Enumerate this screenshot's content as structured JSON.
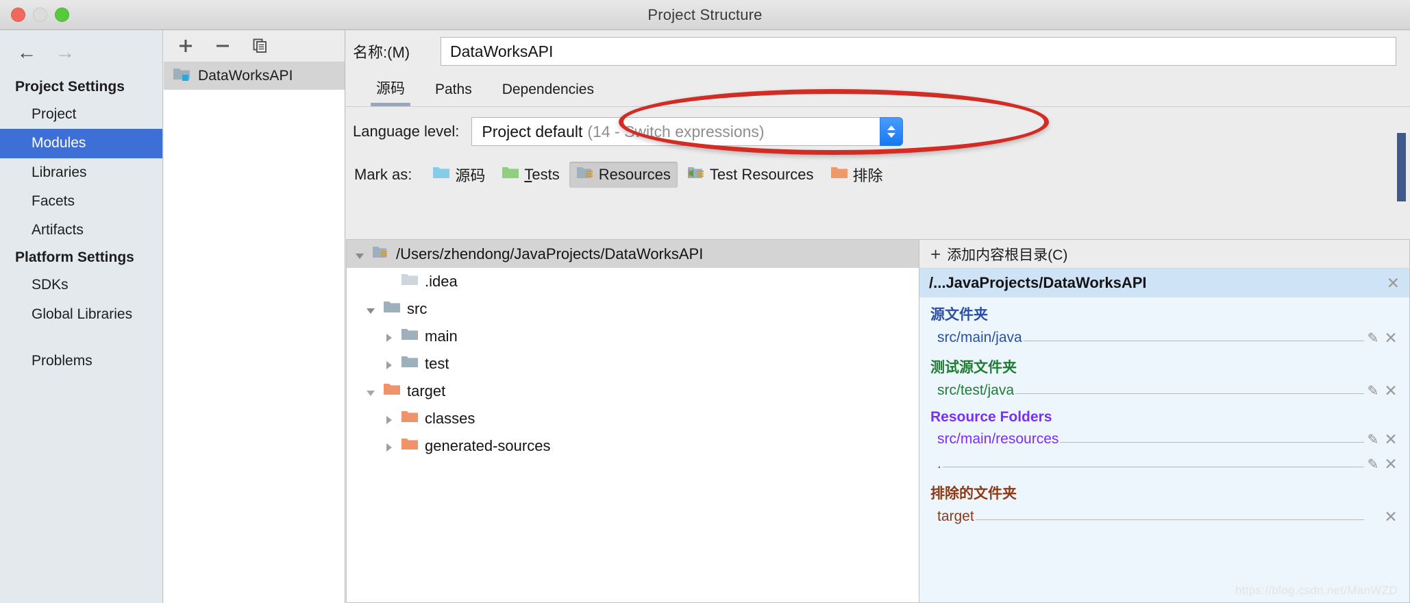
{
  "window": {
    "title": "Project Structure",
    "traffic_lights": [
      "close-red",
      "minimize-yellow",
      "zoom-green"
    ]
  },
  "sidebar": {
    "back_icon": "←",
    "forward_icon": "→",
    "groups": [
      {
        "label": "Project Settings",
        "items": [
          {
            "label": "Project",
            "selected": false
          },
          {
            "label": "Modules",
            "selected": true
          },
          {
            "label": "Libraries",
            "selected": false
          },
          {
            "label": "Facets",
            "selected": false
          },
          {
            "label": "Artifacts",
            "selected": false
          }
        ]
      },
      {
        "label": "Platform Settings",
        "items": [
          {
            "label": "SDKs",
            "selected": false
          },
          {
            "label": "Global Libraries",
            "selected": false
          }
        ]
      }
    ],
    "problems_label": "Problems"
  },
  "module_panel": {
    "toolbar": {
      "add": "+",
      "remove": "−",
      "copy": "copy"
    },
    "modules": [
      {
        "label": "DataWorksAPI",
        "selected": true
      }
    ]
  },
  "detail": {
    "name_label": "名称:(M)",
    "name_value": "DataWorksAPI",
    "tabs": [
      {
        "label": "源码",
        "active": true
      },
      {
        "label": "Paths",
        "active": false
      },
      {
        "label": "Dependencies",
        "active": false
      }
    ],
    "language_level": {
      "label": "Language level:",
      "value_main": "Project default",
      "value_sub": "(14 - Switch expressions)"
    },
    "mark_as": {
      "label": "Mark as:",
      "buttons": [
        {
          "label": "源码",
          "underline": "",
          "color": "#86cbe8",
          "pressed": false
        },
        {
          "label": "ests",
          "underline": "T",
          "color": "#8fd07f",
          "pressed": false
        },
        {
          "label": "Resources",
          "underline": "",
          "color": "#9fb0bd",
          "pressed": true
        },
        {
          "label": "Test Resources",
          "underline": "",
          "color": "#9fb0bd",
          "pressed": false
        },
        {
          "label": "排除",
          "underline": "",
          "color": "#ef9868",
          "pressed": false
        }
      ]
    },
    "tree": {
      "root": {
        "label": "/Users/zhendong/JavaProjects/DataWorksAPI",
        "expanded": true,
        "color": "#9fb0bd",
        "selected": true
      },
      "nodes": [
        {
          "label": ".idea",
          "depth": 1,
          "arrow": "none",
          "color": "#cdd6dd"
        },
        {
          "label": "src",
          "depth": 1,
          "arrow": "expanded",
          "color": "#9fb0bd"
        },
        {
          "label": "main",
          "depth": 2,
          "arrow": "collapsed",
          "color": "#9fb0bd"
        },
        {
          "label": "test",
          "depth": 2,
          "arrow": "collapsed",
          "color": "#9fb0bd"
        },
        {
          "label": "target",
          "depth": 1,
          "arrow": "expanded",
          "color": "#f0926a"
        },
        {
          "label": "classes",
          "depth": 2,
          "arrow": "collapsed",
          "color": "#f0926a"
        },
        {
          "label": "generated-sources",
          "depth": 2,
          "arrow": "collapsed",
          "color": "#f0926a"
        }
      ]
    },
    "content_roots": {
      "add_label": "添加内容根目录(C)",
      "add_mnemonic": "C",
      "selected_root": "/...JavaProjects/DataWorksAPI",
      "groups": [
        {
          "title": "源文件夹",
          "kind": "source",
          "paths": [
            {
              "path": "src/main/java",
              "editable": true,
              "removable": true
            }
          ]
        },
        {
          "title": "测试源文件夹",
          "kind": "test",
          "paths": [
            {
              "path": "src/test/java",
              "editable": true,
              "removable": true
            }
          ]
        },
        {
          "title": "Resource Folders",
          "kind": "resource",
          "paths": [
            {
              "path": "src/main/resources",
              "editable": true,
              "removable": true
            },
            {
              "path": ".",
              "editable": true,
              "removable": true
            }
          ]
        },
        {
          "title": "排除的文件夹",
          "kind": "excluded",
          "paths": [
            {
              "path": "target",
              "editable": false,
              "removable": true
            }
          ]
        }
      ]
    }
  },
  "watermark": "https://blog.csdn.net/ManWZD",
  "colors": {
    "accent_selected": "#3d6fd6",
    "annotation_red": "#d32c25",
    "roots_bg": "#eef6fd",
    "source_blue": "#2b4fa2",
    "test_green": "#1e7d32",
    "resource_purple": "#7b2ff2",
    "excluded_brown": "#8f3a12"
  }
}
